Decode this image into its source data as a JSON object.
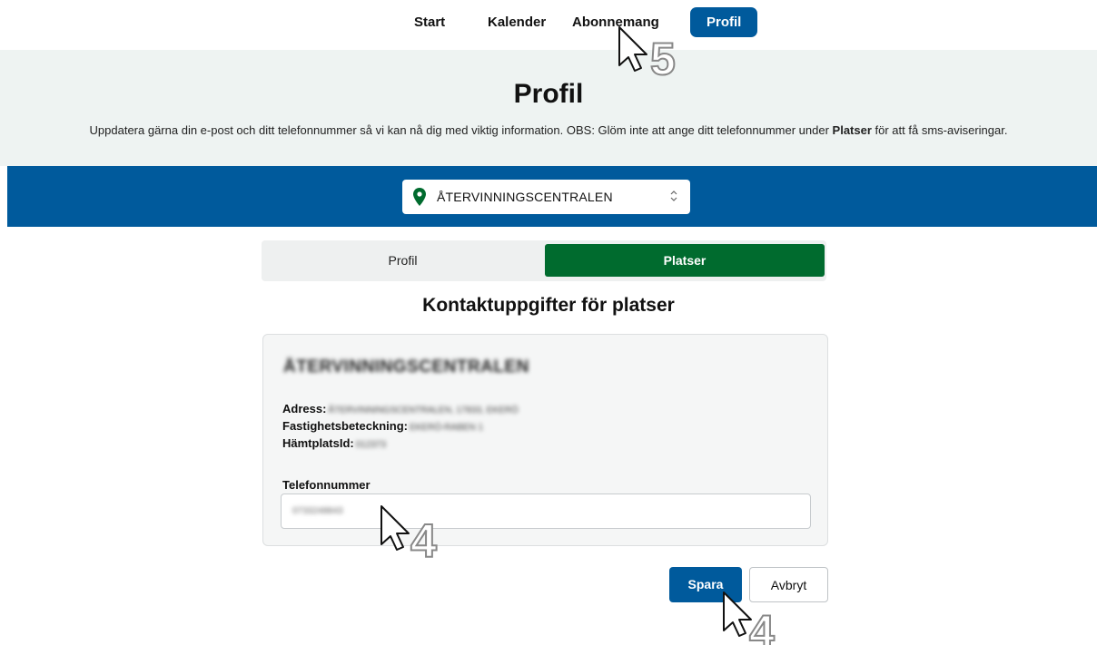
{
  "nav": {
    "items": [
      "Start",
      "Kalender",
      "Abonnemang"
    ],
    "active": "Profil"
  },
  "hero": {
    "title": "Profil",
    "desc_pre": "Uppdatera gärna din e-post och ditt telefonnummer så vi kan nå dig med viktig information. OBS: Glöm inte att ange ditt telefonnummer under ",
    "desc_bold": "Platser",
    "desc_post": " för att få sms-aviseringar."
  },
  "location_select": {
    "value": "ÅTERVINNINGSCENTRALEN",
    "icon": "location-pin-icon"
  },
  "tabs": {
    "profil": "Profil",
    "platser": "Platser",
    "active": "Platser"
  },
  "section_title": "Kontaktuppgifter för platser",
  "card": {
    "place_name": "ÅTERVINNINGSCENTRALEN",
    "adress_label": "Adress:",
    "adress_value": "ÅTERVINNINGSCENTRALEN, 17833, EKERÖ",
    "fastighet_label": "Fastighetsbeteckning:",
    "fastighet_value": "EKERÖ-RABEN 1",
    "hamtplats_label": "HämtplatsId:",
    "hamtplats_value": "012373",
    "tel_label": "Telefonnummer",
    "tel_value": "0733248843"
  },
  "buttons": {
    "save": "Spara",
    "cancel": "Avbryt"
  },
  "annotations": {
    "step_nav": "5",
    "step_input": "4",
    "step_save": "4"
  },
  "colors": {
    "primary_blue": "#005a9c",
    "active_green": "#006b2e",
    "hero_bg": "#eef3f2"
  }
}
